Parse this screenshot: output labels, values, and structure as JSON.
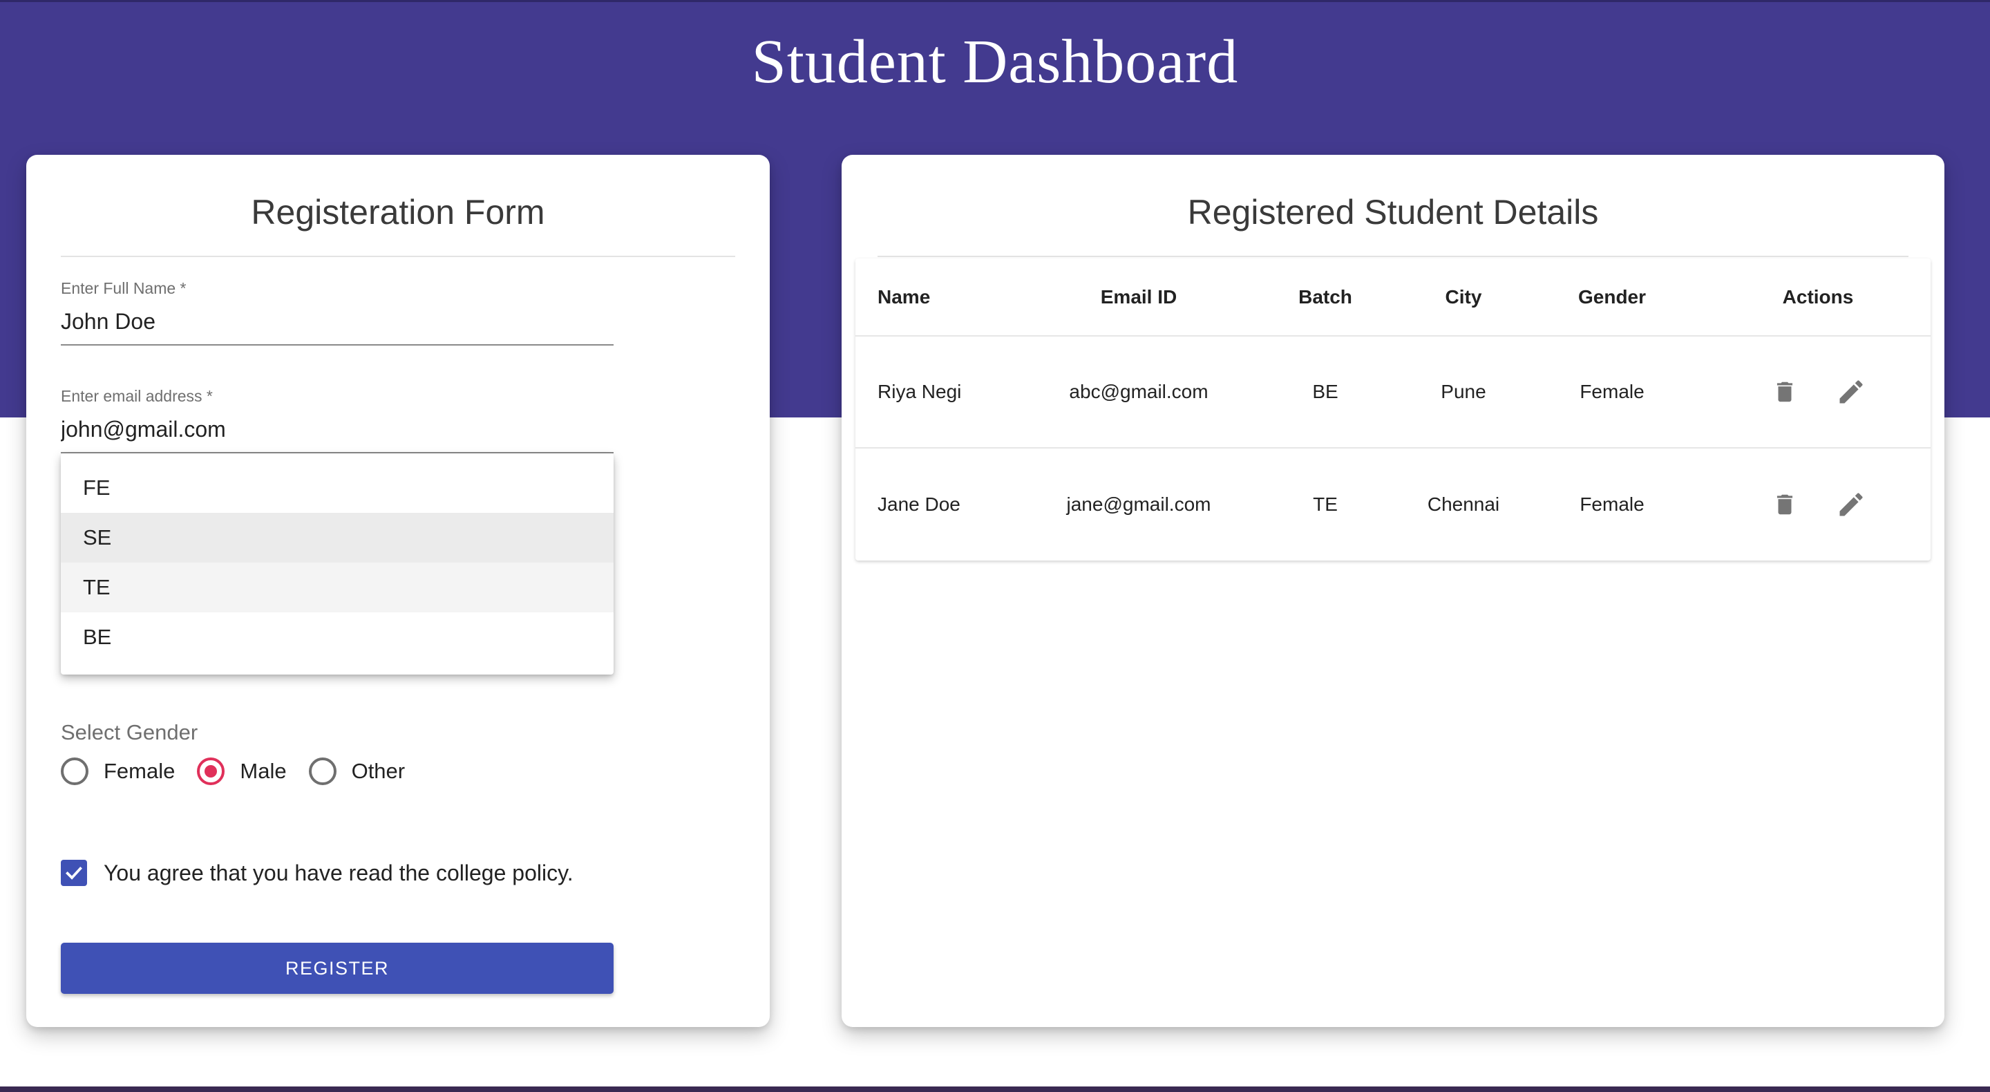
{
  "header": {
    "title": "Student Dashboard"
  },
  "form": {
    "title": "Registeration Form",
    "name_field": {
      "label": "Enter Full Name *",
      "value": "John Doe"
    },
    "email_field": {
      "label": "Enter email address *",
      "value": "john@gmail.com"
    },
    "batch_dropdown": {
      "options": [
        "FE",
        "SE",
        "TE",
        "BE"
      ],
      "hovered": "SE",
      "selected": "TE"
    },
    "gender": {
      "label": "Select Gender",
      "options": [
        "Female",
        "Male",
        "Other"
      ],
      "selected": "Male"
    },
    "agreement": {
      "text": "You agree that you have read the college policy.",
      "checked": true
    },
    "register_label": "REGISTER"
  },
  "table": {
    "title": "Registered Student Details",
    "columns": [
      "Name",
      "Email ID",
      "Batch",
      "City",
      "Gender",
      "Actions"
    ],
    "rows": [
      {
        "name": "Riya Negi",
        "email": "abc@gmail.com",
        "batch": "BE",
        "city": "Pune",
        "gender": "Female"
      },
      {
        "name": "Jane Doe",
        "email": "jane@gmail.com",
        "batch": "TE",
        "city": "Chennai",
        "gender": "Female"
      }
    ],
    "action_icons": [
      "delete-icon",
      "edit-icon"
    ]
  },
  "colors": {
    "header_bg": "#433a8f",
    "primary": "#3f51b5",
    "radio_accent": "#e0305a",
    "icon_gray": "#757575"
  }
}
